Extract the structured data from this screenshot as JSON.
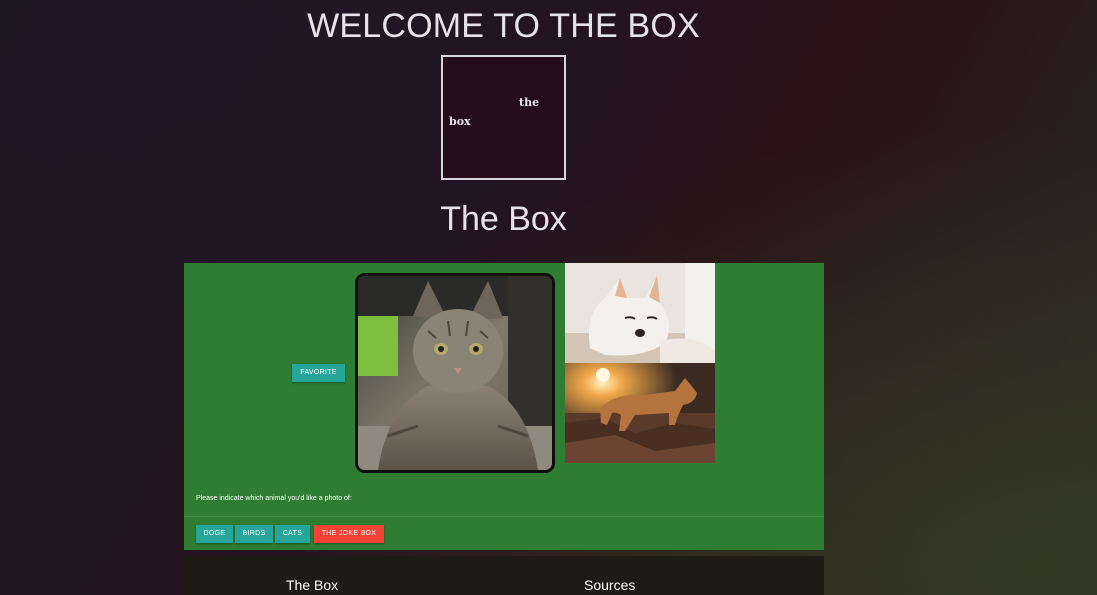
{
  "header": {
    "heading": "WELCOME TO THE BOX",
    "subtitle": "The Box"
  },
  "logo": {
    "word_1": "the",
    "word_2": "box"
  },
  "panel": {
    "background_color": "#2e7d32",
    "favorite_label": "FAVORITE",
    "prompt": "Please indicate which animal you'd like a photo of:",
    "choices": [
      {
        "label": "DOGE",
        "color": "#26a69a"
      },
      {
        "label": "BIRDS",
        "color": "#26a69a"
      },
      {
        "label": "CATS",
        "color": "#26a69a"
      },
      {
        "label": "THE JOKE BOX",
        "color": "#f44336"
      }
    ],
    "photos": [
      "cat-photo",
      "dog-lying-photo",
      "dog-sunset-photo"
    ]
  },
  "footer": {
    "col_1_title": "The Box",
    "col_2_title": "Sources"
  }
}
